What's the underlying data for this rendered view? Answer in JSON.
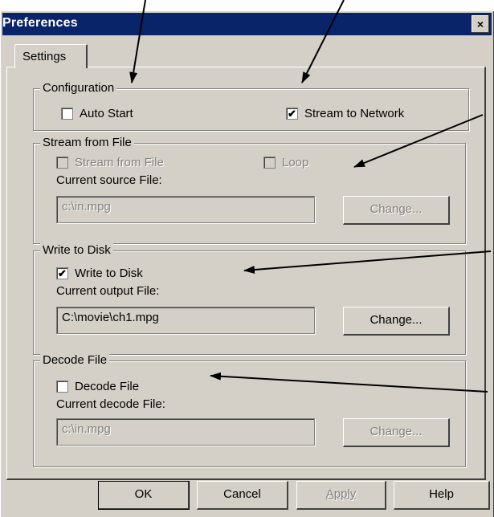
{
  "window": {
    "title": "Preferences",
    "close_glyph": "×"
  },
  "tabs": [
    {
      "label": "Settings"
    }
  ],
  "configuration": {
    "legend": "Configuration",
    "auto_start": {
      "label": "Auto Start",
      "checked": false
    },
    "stream_to_network": {
      "label": "Stream to Network",
      "checked": true
    }
  },
  "stream_from_file": {
    "legend": "Stream from File",
    "stream_checkbox": {
      "label": "Stream from File",
      "checked": false,
      "enabled": false
    },
    "loop_checkbox": {
      "label": "Loop",
      "checked": false,
      "enabled": false
    },
    "current_label": "Current source File:",
    "file_value": "c:\\in.mpg",
    "change_label": "Change..."
  },
  "write_to_disk": {
    "legend": "Write to Disk",
    "write_checkbox": {
      "label": "Write to Disk",
      "checked": true
    },
    "current_label": "Current output File:",
    "file_value": "C:\\movie\\ch1.mpg",
    "change_label": "Change..."
  },
  "decode_file": {
    "legend": "Decode File",
    "decode_checkbox": {
      "label": "Decode File",
      "checked": false
    },
    "current_label": "Current decode File:",
    "file_value": "c:\\in.mpg",
    "change_label": "Change..."
  },
  "buttons": {
    "ok": "OK",
    "cancel": "Cancel",
    "apply": "Apply",
    "help": "Help"
  },
  "check_glyph": "✔"
}
